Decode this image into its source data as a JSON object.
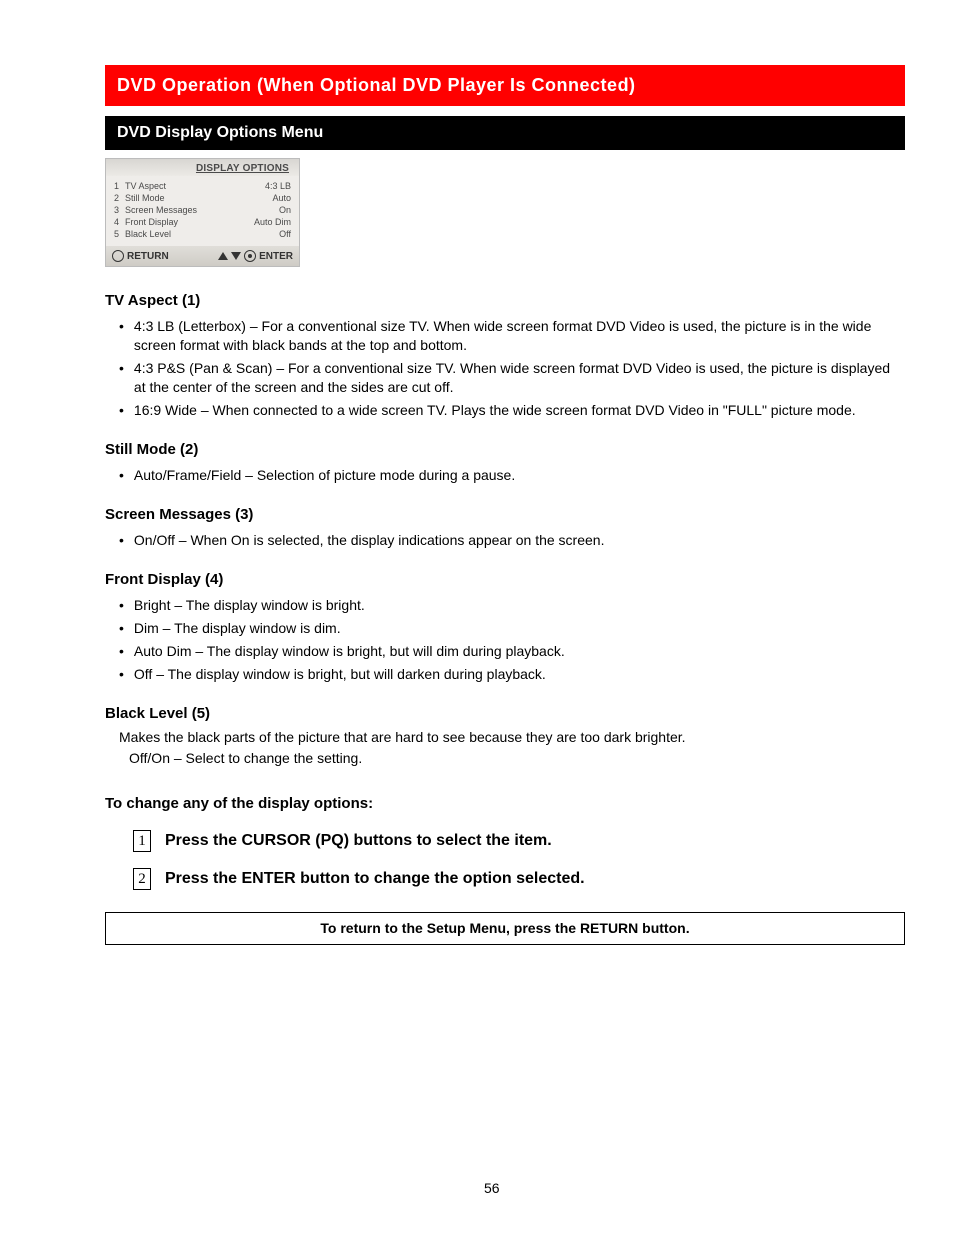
{
  "header": {
    "red_title": "DVD Operation (When Optional DVD Player Is Connected)",
    "black_title": "DVD Display Options Menu"
  },
  "screenshot": {
    "title": "DISPLAY OPTIONS",
    "rows": [
      {
        "n": "1",
        "label": "TV Aspect",
        "value": "4:3 LB"
      },
      {
        "n": "2",
        "label": "Still Mode",
        "value": "Auto"
      },
      {
        "n": "3",
        "label": "Screen Messages",
        "value": "On"
      },
      {
        "n": "4",
        "label": "Front Display",
        "value": "Auto Dim"
      },
      {
        "n": "5",
        "label": "Black Level",
        "value": "Off"
      }
    ],
    "return": "RETURN",
    "enter": "ENTER"
  },
  "items": {
    "tv_aspect": {
      "title": "TV Aspect (1)",
      "bullets": [
        "4:3 LB (Letterbox) – For a conventional size TV. When wide screen format DVD Video is used, the picture is in the wide screen format with black bands at the top and bottom.",
        "4:3 P&S (Pan & Scan) – For a conventional size TV. When wide screen format DVD Video is used, the picture is displayed at the center of the screen and the sides are cut off.",
        "16:9 Wide – When connected to a wide screen TV. Plays the wide screen format DVD Video in \"FULL\" picture mode."
      ]
    },
    "still_mode": {
      "title": "Still Mode (2)",
      "bullets": [
        "Auto/Frame/Field – Selection of picture mode during a pause."
      ]
    },
    "screen_msg": {
      "title": "Screen Messages (3)",
      "bullets": [
        "On/Off – When On is selected, the display indications appear on the screen."
      ]
    },
    "front_display": {
      "title": "Front Display (4)",
      "bullets": [
        "Bright – The display window is bright.",
        "Dim – The display window is dim.",
        "Auto Dim – The display window is bright, but will dim during playback.",
        "Off – The display window is bright, but will darken during playback."
      ]
    },
    "black_level": {
      "title": "Black Level (5)",
      "desc": "Makes the black parts of the picture that are hard to see because they are too dark brighter.",
      "sub": "Off/On – Select to change the setting."
    }
  },
  "tochange": "To change any of the display options:",
  "steps": [
    "Press the CURSOR (PQ) buttons to select the item.",
    "Press the ENTER button to change the option selected."
  ],
  "note": "To return to the Setup Menu, press the RETURN button.",
  "page_number": "56"
}
